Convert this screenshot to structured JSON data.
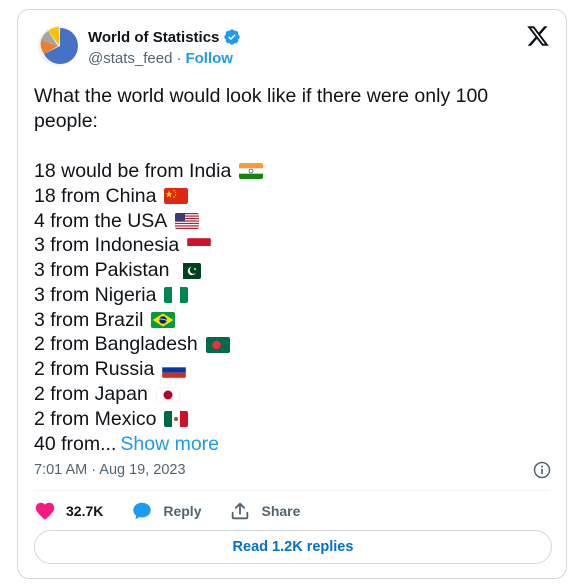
{
  "account": {
    "name": "World of Statistics",
    "handle": "@stats_feed",
    "separator": "·",
    "follow_label": "Follow",
    "verified_icon": "verified-badge-icon",
    "brand_color": "#1d9bf0"
  },
  "tweet": {
    "intro": "What the world would look like if there were only 100 people:",
    "lines": [
      {
        "text": "18 would be from India",
        "flag": "india-flag-icon"
      },
      {
        "text": "18 from China",
        "flag": "china-flag-icon"
      },
      {
        "text": "4 from the USA",
        "flag": "usa-flag-icon"
      },
      {
        "text": "3 from Indonesia",
        "flag": "indonesia-flag-icon"
      },
      {
        "text": "3 from Pakistan",
        "flag": "pakistan-flag-icon"
      },
      {
        "text": "3 from Nigeria",
        "flag": "nigeria-flag-icon"
      },
      {
        "text": "3 from Brazil",
        "flag": "brazil-flag-icon"
      },
      {
        "text": "2 from Bangladesh",
        "flag": "bangladesh-flag-icon"
      },
      {
        "text": "2 from Russia",
        "flag": "russia-flag-icon"
      },
      {
        "text": "2 from Japan",
        "flag": "japan-flag-icon"
      },
      {
        "text": "2 from Mexico",
        "flag": "mexico-flag-icon"
      }
    ],
    "truncated_line": "40 from...",
    "show_more_label": "Show more",
    "timestamp": "7:01 AM · Aug 19, 2023"
  },
  "actions": {
    "likes": "32.7K",
    "reply_label": "Reply",
    "share_label": "Share",
    "like_color": "#f91880"
  },
  "replies_button": "Read 1.2K replies"
}
